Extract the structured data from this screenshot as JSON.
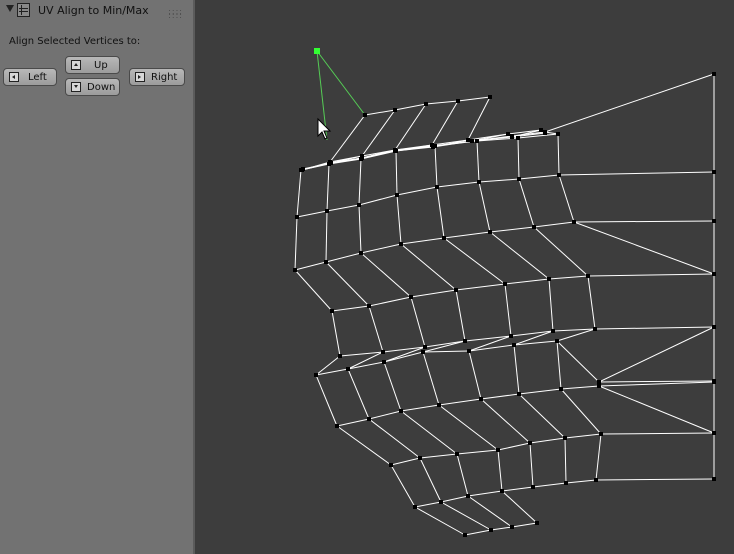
{
  "panel": {
    "title": "UV Align to Min/Max",
    "prompt": "Align Selected Vertices to:",
    "buttons": {
      "left": "Left",
      "up": "Up",
      "down": "Down",
      "right": "Right"
    }
  },
  "colors": {
    "panel_bg": "#727272",
    "viewport_bg": "#3d3d3d",
    "mesh_edge": "#ffffff",
    "vertex": "#000000",
    "selected_vertex": "#33ff33",
    "selected_edge": "#55cc55"
  },
  "icons": {
    "collapse": "triangle-down-icon",
    "panel": "uv-grid-icon",
    "grip": "drag-grip-icon",
    "left": "align-left-icon",
    "up": "align-up-icon",
    "down": "align-down-icon",
    "right": "align-right-icon",
    "cursor": "mouse-pointer-icon"
  }
}
